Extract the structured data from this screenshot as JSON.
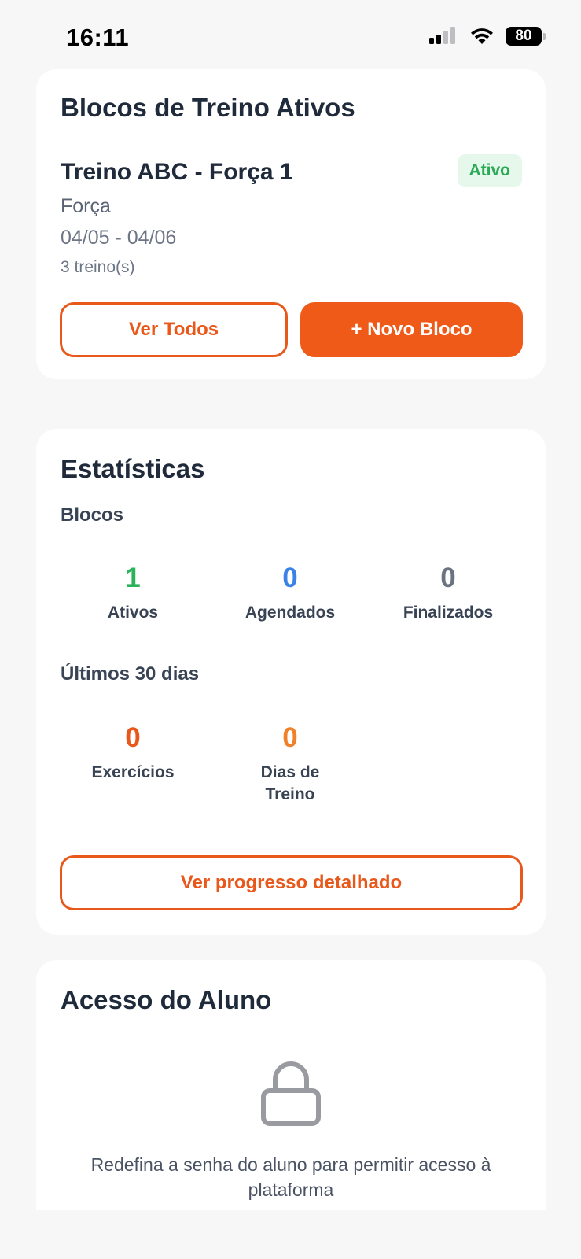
{
  "status_bar": {
    "time": "16:11",
    "battery": "80"
  },
  "active_blocks": {
    "title": "Blocos de Treino Ativos",
    "block": {
      "name": "Treino ABC - Força 1",
      "status": "Ativo",
      "type": "Força",
      "dates": "04/05 - 04/06",
      "count": "3 treino(s)"
    },
    "view_all_label": "Ver Todos",
    "new_block_label": "+ Novo Bloco"
  },
  "statistics": {
    "title": "Estatísticas",
    "blocks_label": "Blocos",
    "blocks": [
      {
        "value": "1",
        "label": "Ativos",
        "color": "#2bb35a"
      },
      {
        "value": "0",
        "label": "Agendados",
        "color": "#3b82e6"
      },
      {
        "value": "0",
        "label": "Finalizados",
        "color": "#6b7280"
      }
    ],
    "last30_label": "Últimos 30 dias",
    "last30": [
      {
        "value": "0",
        "label": "Exercícios",
        "color": "#e9581b"
      },
      {
        "value": "0",
        "label": "Dias de Treino",
        "color": "#f0802a"
      }
    ],
    "progress_label": "Ver progresso detalhado"
  },
  "student_access": {
    "title": "Acesso do Aluno",
    "icon": "lock-icon",
    "message": "Redefina a senha do aluno para permitir acesso à plataforma"
  },
  "colors": {
    "accent": "#ef5a19",
    "active_badge_bg": "#e6f7ec",
    "active_badge_text": "#2aaa55"
  }
}
